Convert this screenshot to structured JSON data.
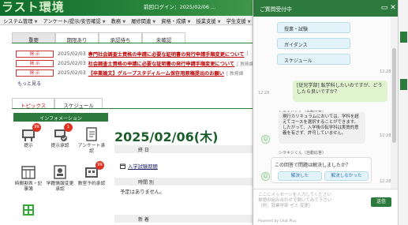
{
  "header": {
    "title": "ラスト環境",
    "notice": "前回ログイン：2025/02/06 ..."
  },
  "menu": [
    "システム管理",
    "アンケート/提示/安否確認",
    "教務",
    "履修関連",
    "資格・成績",
    "授業支援",
    "学生支援"
  ],
  "announcement_tabs": [
    "重要",
    "期限あり",
    "承認待ち",
    "未確認"
  ],
  "announcements": [
    {
      "badge": "掲 示",
      "date": "2025/02/03",
      "title": "専門社会調査士資格の申請に必要な証明書の発行申請手順変更について",
      "extra": "["
    },
    {
      "badge": "掲 示",
      "date": "2025/02/03",
      "title": "社会調査士資格の申請に必要な証明書の発行申請手順変更について",
      "extra": "[ 教務課"
    },
    {
      "badge": "掲 示",
      "date": "2025/02/03",
      "title": "【卒業論文】グループスタディルーム保存用原稿提出のお願い",
      "extra": "[ 教務課"
    }
  ],
  "more_link": "もっと見る",
  "topic_tabs": [
    "トピックス",
    "スケジュール"
  ],
  "info_header": "インフォメーション",
  "icons": [
    {
      "label": "提示",
      "icon": "notice-board-icon",
      "badge": "99"
    },
    {
      "label": "提示承認",
      "icon": "approval-icon",
      "badge": "1"
    },
    {
      "label": "アンケート承認",
      "icon": "survey-icon",
      "badge": ""
    },
    {
      "label": "時間割表・記事簿",
      "icon": "timetable-icon",
      "badge": ""
    },
    {
      "label": "学籍情報変更承認",
      "icon": "student-record-icon",
      "badge": ""
    },
    {
      "label": "教室予約承認",
      "icon": "room-reservation-icon",
      "badge": "99"
    }
  ],
  "main": {
    "date": "2025/02/06(木)",
    "section_headers": [
      "終 日",
      "時間 別",
      "新 着"
    ],
    "allday_item": "入学試験期間",
    "no_schedule": "予定はありません。"
  },
  "chat": {
    "title": "ご質問受付中",
    "options": [
      "授業・試験",
      "ガイダンス",
      "スケジュール"
    ],
    "option_time": "12:28",
    "user_message": "[従兄学部] 転学科したいのですが、どうしたら良いですか？",
    "user_time": "12:28",
    "bot_name": "シラキジくん（自動応答）",
    "bot_message": "現行カリキュラムにおいては、学科を超えてコースを選択することができます。\nしたがって、入学後の転学科は実質的意義を有さず、許可していません。",
    "bot_time": "12:28",
    "survey_name": "シラキジくん（自動応答）",
    "survey_question": "この回答で問題は解決しましたか？",
    "survey_yes": "解決した",
    "survey_no": "解決しなかった",
    "survey_time": "12:28",
    "input_placeholder": "ここにメッセージを入力してください\n単語の組み合わせで聞いてみて下さい\n（例：就業学部 ゼミ 変更）",
    "send_label": "送信",
    "powered": "Powered by Chat Plus"
  },
  "colors": {
    "brand_green": "#2c7a3c",
    "alert_red": "#cc3333",
    "option_blue": "#e3f3fa"
  }
}
